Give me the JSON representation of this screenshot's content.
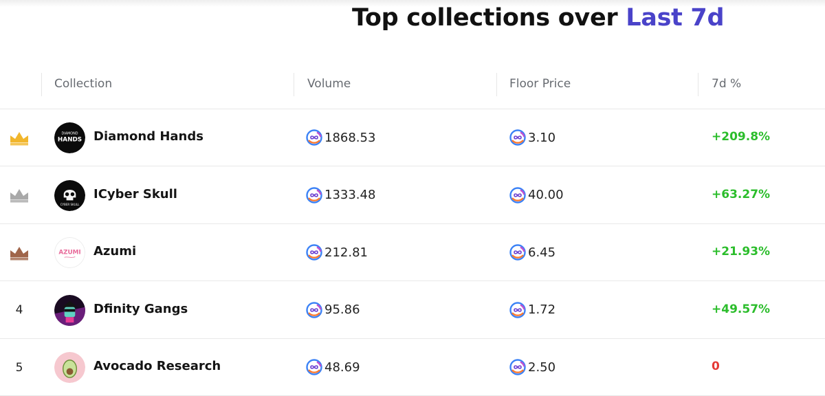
{
  "title": {
    "prefix": "Top collections over",
    "period": "Last 7d"
  },
  "colors": {
    "accent": "#4a43c9",
    "positive": "#2bbd2b",
    "negative": "#e53935",
    "gold": "#f1b62c",
    "silver": "#a9a9a9",
    "bronze": "#a0654a"
  },
  "table": {
    "headers": [
      "Collection",
      "Volume",
      "Floor Price",
      "7d %"
    ],
    "rows": [
      {
        "rank": "",
        "rank_icon": "gold-crown-icon",
        "name": "Diamond Hands",
        "volume": "1868.53",
        "floor": "3.10",
        "change": "+209.8%",
        "trend": "positive",
        "avatar": "diamond-hands-logo"
      },
      {
        "rank": "",
        "rank_icon": "silver-crown-icon",
        "name": "ICyber Skull",
        "volume": "1333.48",
        "floor": "40.00",
        "change": "+63.27%",
        "trend": "positive",
        "avatar": "cyber-skull-logo"
      },
      {
        "rank": "",
        "rank_icon": "bronze-crown-icon",
        "name": "Azumi",
        "volume": "212.81",
        "floor": "6.45",
        "change": "+21.93%",
        "trend": "positive",
        "avatar": "azumi-logo"
      },
      {
        "rank": "4",
        "rank_icon": "",
        "name": "Dfinity Gangs",
        "volume": "95.86",
        "floor": "1.72",
        "change": "+49.57%",
        "trend": "positive",
        "avatar": "dfinity-gangs-logo"
      },
      {
        "rank": "5",
        "rank_icon": "",
        "name": "Avocado Research",
        "volume": "48.69",
        "floor": "2.50",
        "change": "0",
        "trend": "negative",
        "avatar": "avocado-research-logo"
      }
    ]
  },
  "currency_icon": "icp-token-icon",
  "avatar_text": {
    "diamond_top": "DIAMOND",
    "diamond_main": "HANDS",
    "skull_sub": "CYBER SKULL",
    "azumi": "AZUMI"
  }
}
